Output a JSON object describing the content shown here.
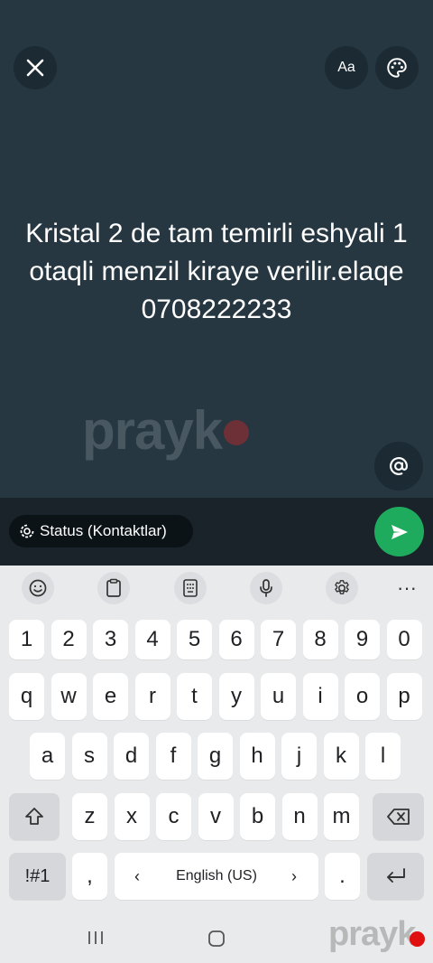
{
  "status_text": "Kristal 2 de tam temirli eshyali 1 otaqli menzil kiraye verilir.elaqe 0708222233",
  "toolbar": {
    "font_label": "Aa"
  },
  "audience": {
    "label": "Status (Kontaktlar)"
  },
  "watermark": {
    "text": "prayk"
  },
  "keyboard": {
    "row_numbers": [
      "1",
      "2",
      "3",
      "4",
      "5",
      "6",
      "7",
      "8",
      "9",
      "0"
    ],
    "row_top": [
      "q",
      "w",
      "e",
      "r",
      "t",
      "y",
      "u",
      "i",
      "o",
      "p"
    ],
    "row_middle": [
      "a",
      "s",
      "d",
      "f",
      "g",
      "h",
      "j",
      "k",
      "l"
    ],
    "row_bottom": [
      "z",
      "x",
      "c",
      "v",
      "b",
      "n",
      "m"
    ],
    "symbols_label": "!#1",
    "comma": ",",
    "period": ".",
    "space_label": "English (US)",
    "toolbar_more": "···"
  },
  "colors": {
    "status_bg": "#263742",
    "send_button": "#1eab5e",
    "keyboard_bg": "#e9eaec"
  }
}
